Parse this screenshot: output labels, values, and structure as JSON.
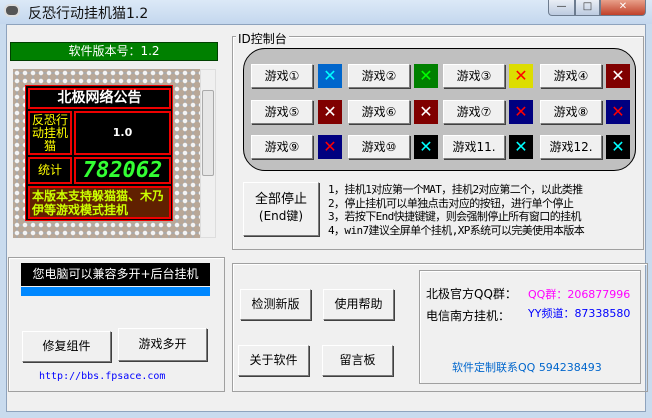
{
  "window": {
    "title": "反恐行动挂机猫1.2",
    "minimize": "—",
    "maximize": "□",
    "close": "✕"
  },
  "left": {
    "version": "软件版本号：1.2",
    "notice": {
      "heading": "北极网络公告",
      "app_name": "反恐行动挂机猫",
      "app_version": "1.0",
      "stat_label": "统计",
      "stat_value": "782062",
      "message": "本版本支持躲猫猫、木乃伊等游戏模式挂机"
    },
    "compat_text": "您电脑可以兼容多开+后台挂机",
    "repair_label": "修复组件",
    "multi_label": "游戏多开",
    "link": "http://bbs.fpsace.com"
  },
  "console": {
    "title": "ID控制台",
    "games": [
      {
        "label": "游戏①",
        "bg": "#0066cc",
        "x": "#00ffff"
      },
      {
        "label": "游戏②",
        "bg": "#008000",
        "x": "#00ff00"
      },
      {
        "label": "游戏③",
        "bg": "#dddd00",
        "x": "#ff0000"
      },
      {
        "label": "游戏④",
        "bg": "#800000",
        "x": "#ffffff"
      },
      {
        "label": "游戏⑤",
        "bg": "#800000",
        "x": "#ffffff"
      },
      {
        "label": "游戏⑥",
        "bg": "#800000",
        "x": "#ffffff"
      },
      {
        "label": "游戏⑦",
        "bg": "#000080",
        "x": "#ff0000"
      },
      {
        "label": "游戏⑧",
        "bg": "#000080",
        "x": "#ff0000"
      },
      {
        "label": "游戏⑨",
        "bg": "#000080",
        "x": "#ff0000"
      },
      {
        "label": "游戏⑩",
        "bg": "#000000",
        "x": "#00ffff"
      },
      {
        "label": "游戏11.",
        "bg": "#000000",
        "x": "#00ffff"
      },
      {
        "label": "游戏12.",
        "bg": "#000000",
        "x": "#00ffff"
      }
    ],
    "x_glyph": "✕",
    "stop_all": "全部停止",
    "stop_key": "(End键)",
    "instructions": [
      "1，挂机1对应第一个MAT，挂机2对应第二个，以此类推",
      "2，停止挂机可以单独点击对应的按钮，进行单个停止",
      "3，若按下End快捷键键，则会强制停止所有窗口的挂机",
      "4，win7建议全屏单个挂机,XP系统可以完美使用本版本"
    ]
  },
  "tools": {
    "check_update": "检测新版",
    "help": "使用帮助",
    "about": "关于软件",
    "guestbook": "留言板"
  },
  "info": {
    "qq_group_label": "北极官方QQ群：",
    "qq_group_value": "QQ群：206877996",
    "yy_label": "电信南方挂机：",
    "yy_value": "YY频道：87338580",
    "custom": "软件定制联系QQ 594238493"
  }
}
